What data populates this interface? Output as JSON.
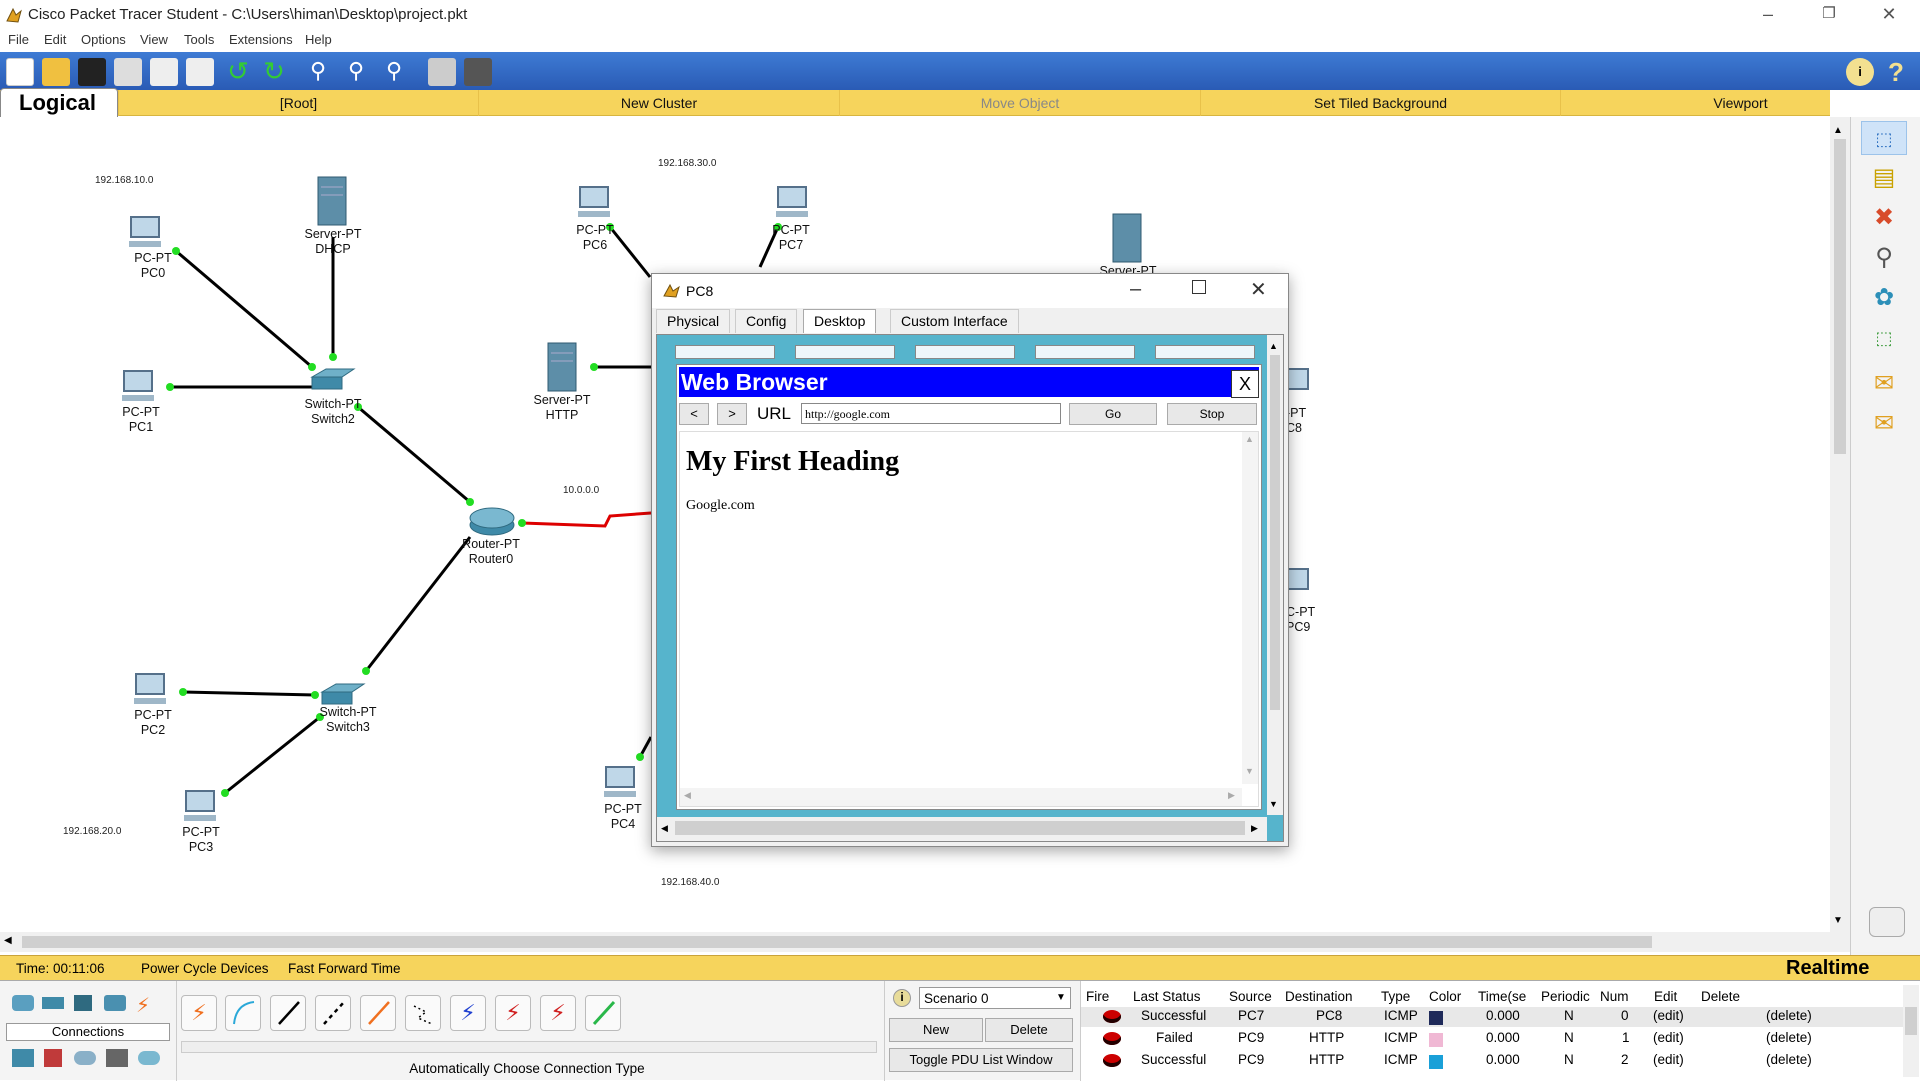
{
  "window": {
    "title": "Cisco Packet Tracer Student - C:\\Users\\himan\\Desktop\\project.pkt"
  },
  "menu": [
    "File",
    "Edit",
    "Options",
    "View",
    "Tools",
    "Extensions",
    "Help"
  ],
  "navbar": {
    "tab": "Logical",
    "items": [
      "[Root]",
      "New Cluster",
      "Move Object",
      "Set Tiled Background",
      "Viewport"
    ]
  },
  "networks": [
    "192.168.10.0",
    "192.168.30.0",
    "10.0.0.0",
    "192.168.20.0",
    "192.168.40.0"
  ],
  "devices": [
    {
      "type": "PC-PT",
      "name": "PC0"
    },
    {
      "type": "Server-PT",
      "name": "DHCP"
    },
    {
      "type": "PC-PT",
      "name": "PC1"
    },
    {
      "type": "Switch-PT",
      "name": "Switch2"
    },
    {
      "type": "PC-PT",
      "name": "PC6"
    },
    {
      "type": "PC-PT",
      "name": "PC7"
    },
    {
      "type": "Server-PT",
      "name": "HTTP"
    },
    {
      "type": "Router-PT",
      "name": "Router0"
    },
    {
      "type": "PC-PT",
      "name": "PC2"
    },
    {
      "type": "Switch-PT",
      "name": "Switch3"
    },
    {
      "type": "PC-PT",
      "name": "PC3"
    },
    {
      "type": "PC-PT",
      "name": "PC4"
    },
    {
      "type": "Server-PT",
      "name": ""
    },
    {
      "type": "-PT",
      "name": "C8"
    },
    {
      "type": "C-PT",
      "name": "PC9"
    }
  ],
  "pc_window": {
    "title": "PC8",
    "tabs": [
      "Physical",
      "Config",
      "Desktop",
      "Custom Interface"
    ],
    "active_tab": "Desktop",
    "browser": {
      "title": "Web Browser",
      "close": "X",
      "back": "<",
      "forward": ">",
      "url_label": "URL",
      "url": "http://google.com",
      "go": "Go",
      "stop": "Stop",
      "heading": "My First Heading",
      "body": "Google.com"
    }
  },
  "status": {
    "time": "Time: 00:11:06",
    "power_cycle": "Power Cycle Devices",
    "fast_forward": "Fast Forward Time",
    "mode": "Realtime"
  },
  "device_panel": {
    "category": "Connections",
    "tooltip": "Automatically Choose Connection Type"
  },
  "scenario": {
    "selected": "Scenario 0",
    "new": "New",
    "delete": "Delete",
    "toggle": "Toggle PDU List Window"
  },
  "pdu_table": {
    "headers": [
      "Fire",
      "Last Status",
      "Source",
      "Destination",
      "Type",
      "Color",
      "Time(se",
      "Periodic",
      "Num",
      "Edit",
      "Delete"
    ],
    "rows": [
      {
        "status": "Successful",
        "source": "PC7",
        "destination": "PC8",
        "type": "ICMP",
        "color": "#1f2a5a",
        "time": "0.000",
        "periodic": "N",
        "num": "0",
        "edit": "(edit)",
        "delete": "(delete)"
      },
      {
        "status": "Failed",
        "source": "PC9",
        "destination": "HTTP",
        "type": "ICMP",
        "color": "#f0b8d4",
        "time": "0.000",
        "periodic": "N",
        "num": "1",
        "edit": "(edit)",
        "delete": "(delete)"
      },
      {
        "status": "Successful",
        "source": "PC9",
        "destination": "HTTP",
        "type": "ICMP",
        "color": "#1aa0d8",
        "time": "0.000",
        "periodic": "N",
        "num": "2",
        "edit": "(edit)",
        "delete": "(delete)"
      }
    ]
  },
  "colors": {
    "toolbar": "#2f64bf",
    "navbar": "#f6d45c",
    "link_ok": "#22dd22",
    "link_serial": "#dd0000",
    "browser_title": "#0000ff",
    "desktop_bg": "#56b4cc"
  }
}
